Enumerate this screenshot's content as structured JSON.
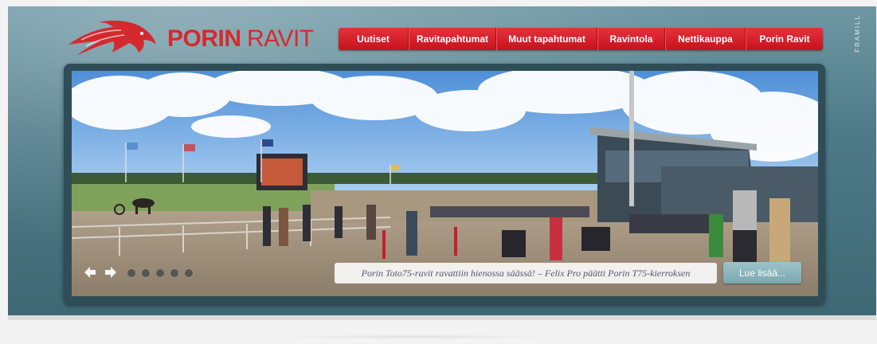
{
  "logo": {
    "brand_strong": "PORIN",
    "brand_light": "RAVIT"
  },
  "side_label": "FRAMILL",
  "nav": {
    "items": [
      {
        "label": "Uutiset"
      },
      {
        "label": "Ravitapahtumat"
      },
      {
        "label": "Muut tapahtumat"
      },
      {
        "label": "Ravintola"
      },
      {
        "label": "Nettikauppa"
      },
      {
        "label": "Porin Ravit"
      }
    ]
  },
  "slider": {
    "caption": "Porin Toto75-ravit ravattiin hienossa säässä! – Felix Pro päätti Porin T75-kierroksen",
    "read_more_label": "Lue lisää...",
    "prev_icon": "arrow-left-icon",
    "next_icon": "arrow-right-icon",
    "dot_count": 5
  },
  "colors": {
    "brand_red": "#d42a2e",
    "nav_red": "#d41e28",
    "band_teal": "#4e7b88",
    "read_more": "#8db7be"
  }
}
